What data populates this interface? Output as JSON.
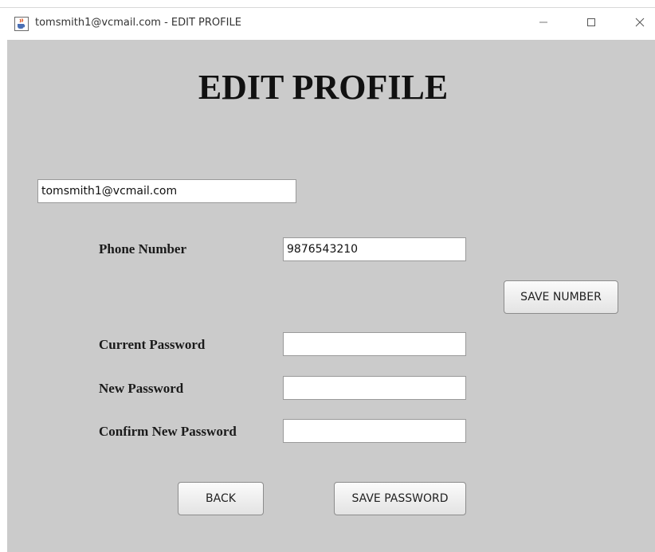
{
  "window": {
    "title": "tomsmith1@vcmail.com - EDIT PROFILE",
    "minimize_glyph": "—",
    "maximize_glyph": "☐",
    "close_glyph": "✕"
  },
  "page": {
    "heading": "EDIT PROFILE"
  },
  "form": {
    "email_value": "tomsmith1@vcmail.com",
    "phone_label": "Phone Number",
    "phone_value": "9876543210",
    "current_password_label": "Current Password",
    "current_password_value": "",
    "new_password_label": "New Password",
    "new_password_value": "",
    "confirm_password_label": "Confirm New Password",
    "confirm_password_value": ""
  },
  "buttons": {
    "save_number": "SAVE NUMBER",
    "back": "BACK",
    "save_password": "SAVE PASSWORD"
  },
  "icons": {
    "app": "java-cup-icon",
    "minimize": "minimize-icon",
    "maximize": "maximize-icon",
    "close": "close-icon"
  }
}
